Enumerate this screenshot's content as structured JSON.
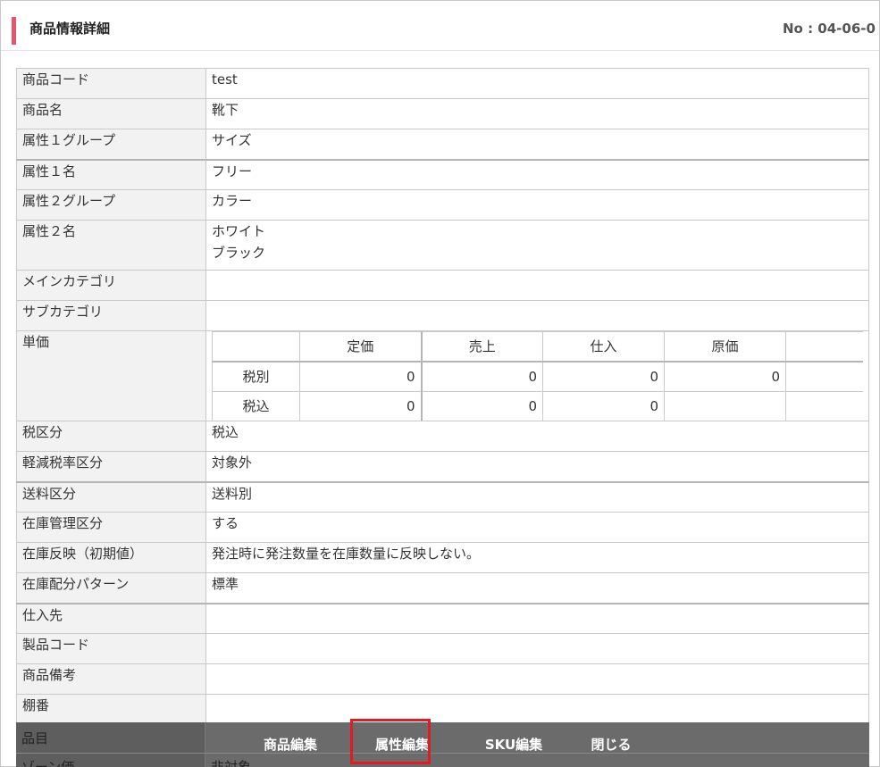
{
  "header": {
    "title": "商品情報詳細",
    "number": "No : 04-06-0"
  },
  "rows": [
    {
      "label": "商品コード",
      "value": "test"
    },
    {
      "label": "商品名",
      "value": "靴下"
    },
    {
      "label": "属性１グループ",
      "value": "サイズ"
    },
    {
      "label": "属性１名",
      "value": "フリー"
    },
    {
      "label": "属性２グループ",
      "value": "カラー"
    },
    {
      "label": "属性２名",
      "value_lines": [
        "ホワイト",
        "ブラック"
      ]
    },
    {
      "label": "メインカテゴリ",
      "value": ""
    },
    {
      "label": "サブカテゴリ",
      "value": ""
    }
  ],
  "price": {
    "label": "単価",
    "headers": [
      "定価",
      "売上",
      "仕入",
      "原価"
    ],
    "rows": [
      {
        "label": "税別",
        "values": [
          "0",
          "0",
          "0",
          "0"
        ]
      },
      {
        "label": "税込",
        "values": [
          "0",
          "0",
          "0",
          ""
        ]
      }
    ]
  },
  "rows2": [
    {
      "label": "税区分",
      "value": "税込"
    },
    {
      "label": "軽減税率区分",
      "value": "対象外"
    },
    {
      "label": "送料区分",
      "value": "送料別"
    },
    {
      "label": "在庫管理区分",
      "value": "する"
    },
    {
      "label": "在庫反映（初期値）",
      "value": "発注時に発注数量を在庫数量に反映しない。"
    },
    {
      "label": "在庫配分パターン",
      "value": "標準"
    },
    {
      "label": "仕入先",
      "value": ""
    },
    {
      "label": "製品コード",
      "value": ""
    },
    {
      "label": "商品備考",
      "value": ""
    },
    {
      "label": "棚番",
      "value": ""
    }
  ],
  "footer_underlay": {
    "label1": "品目",
    "label2": "ゾーン価",
    "value2": "非対象"
  },
  "buttons": {
    "edit_product": "商品編集",
    "edit_attribute": "属性編集",
    "edit_sku": "SKU編集",
    "close": "閉じる"
  }
}
